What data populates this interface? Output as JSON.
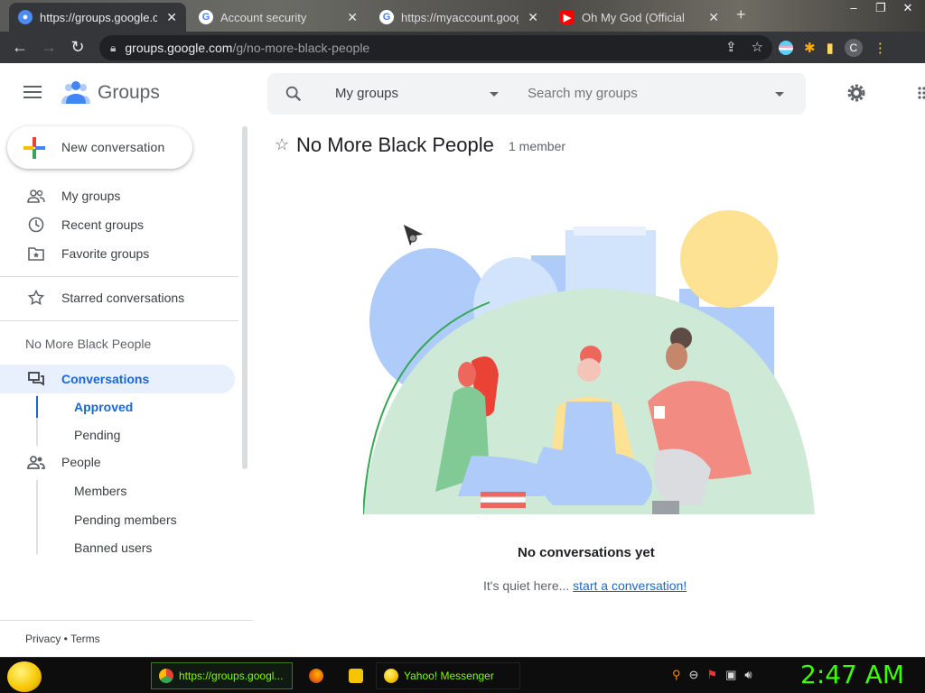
{
  "browser": {
    "tabs": [
      {
        "title": "https://groups.google.com",
        "icon": "groups-favicon"
      },
      {
        "title": "Account security",
        "icon": "google-favicon"
      },
      {
        "title": "https://myaccount.google",
        "icon": "google-favicon"
      },
      {
        "title": "Oh My God (Official",
        "icon": "youtube-favicon"
      }
    ],
    "new_tab": "+",
    "window": {
      "minimize": "–",
      "maximize": "❐",
      "close": "✕"
    },
    "url_host": "groups.google.com",
    "url_path": "/g/no-more-black-people",
    "profile_initial": "C"
  },
  "app": {
    "name": "Groups",
    "search": {
      "scope": "My groups",
      "placeholder": "Search my groups"
    }
  },
  "sidebar": {
    "new_conversation": "New conversation",
    "nav": [
      {
        "label": "My groups",
        "icon": "people-outline-icon"
      },
      {
        "label": "Recent groups",
        "icon": "clock-icon"
      },
      {
        "label": "Favorite groups",
        "icon": "folder-star-icon"
      }
    ],
    "starred": "Starred conversations",
    "group_name": "No More Black People",
    "conversations": {
      "label": "Conversations",
      "items": [
        {
          "label": "Approved",
          "active": true
        },
        {
          "label": "Pending",
          "active": false
        }
      ]
    },
    "people": {
      "label": "People",
      "items": [
        {
          "label": "Members"
        },
        {
          "label": "Pending members"
        },
        {
          "label": "Banned users"
        }
      ]
    },
    "footer": {
      "privacy": "Privacy",
      "sep": " • ",
      "terms": "Terms"
    }
  },
  "main": {
    "title": "No More Black People",
    "member_count": "1 member",
    "empty_title": "No conversations yet",
    "empty_text": "It's quiet here...",
    "empty_link": "start a conversation!"
  },
  "taskbar": {
    "tasks": [
      {
        "label": "https://groups.googl...",
        "icon": "chrome-icon"
      },
      {
        "label": "",
        "icon": "firefox-icon"
      },
      {
        "label": "",
        "icon": "folder-icon"
      },
      {
        "label": "Yahoo! Messenger",
        "icon": "yahoo-messenger-icon"
      }
    ],
    "clock": "2:47 AM"
  },
  "colors": {
    "accent": "#1967d2",
    "active_bg": "#e8f0fe",
    "clock": "#3cff00"
  }
}
